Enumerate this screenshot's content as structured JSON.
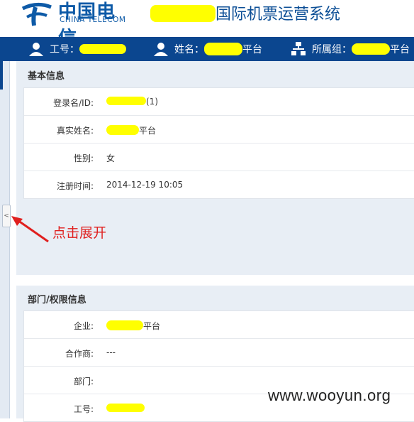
{
  "header": {
    "logo_cn": "中国电信",
    "logo_en": "CHINA TELECOM",
    "system_title": "国际机票运营系统"
  },
  "navbar": {
    "employee_label": "工号：",
    "name_label": "姓名：",
    "name_value_suffix": "平台",
    "group_label": "所属组：",
    "group_value_suffix": "平台"
  },
  "basic_info": {
    "title": "基本信息",
    "rows": [
      {
        "label": "登录名/ID:",
        "value": "(1)"
      },
      {
        "label": "真实姓名:",
        "value": "平台"
      },
      {
        "label": "性别:",
        "value": "女"
      },
      {
        "label": "注册时间:",
        "value": "2014-12-19 10:05"
      }
    ]
  },
  "annotation": "点击展开",
  "collapse_handle": "<",
  "dept_info": {
    "title": "部门/权限信息",
    "rows": [
      {
        "label": "企业:",
        "value": "平台"
      },
      {
        "label": "合作商:",
        "value": "---"
      },
      {
        "label": "部门:",
        "value": ""
      },
      {
        "label": "工号:",
        "value": ""
      }
    ]
  },
  "watermark": "www.wooyun.org",
  "colors": {
    "brand_blue": "#0b468f",
    "highlight": "#ffff00",
    "annotation_red": "#e0201f"
  }
}
